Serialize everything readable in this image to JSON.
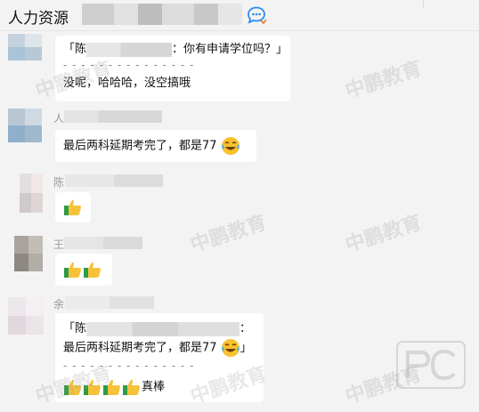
{
  "header": {
    "title": "人力资源",
    "chat_icon": "chat-bubble-icon"
  },
  "messages": [
    {
      "id": "m1",
      "quote_prefix": "「陈",
      "quote_suffix": "：你有申请学位吗？」",
      "separator": "- - - - - - - - - - - - - - -",
      "text": "没呢，哈哈哈，没空搞哦"
    },
    {
      "id": "m2",
      "name_initial": "人",
      "text": "最后两科延期考完了，都是77",
      "emoji": "laugh-cry-emoji"
    },
    {
      "id": "m3",
      "name_initial": "陈",
      "emoji": "thumbs-up-emoji",
      "thumbs": 1
    },
    {
      "id": "m4",
      "name_initial": "王",
      "emoji": "thumbs-up-emoji",
      "thumbs": 2
    },
    {
      "id": "m5",
      "name_initial": "余",
      "quote_prefix": "「陈",
      "quote_suffix": "：",
      "quote_text": "最后两科延期考完了，都是77",
      "quote_close": "」",
      "separator": "- - - - - - - - - - - - - - -",
      "thumbs": 4,
      "text": "真棒"
    }
  ],
  "watermark": "中鹏教育",
  "colors": {
    "background": "#f3f3f3",
    "bubble": "#ffffff",
    "accent_icon": "#2d8cf0"
  }
}
